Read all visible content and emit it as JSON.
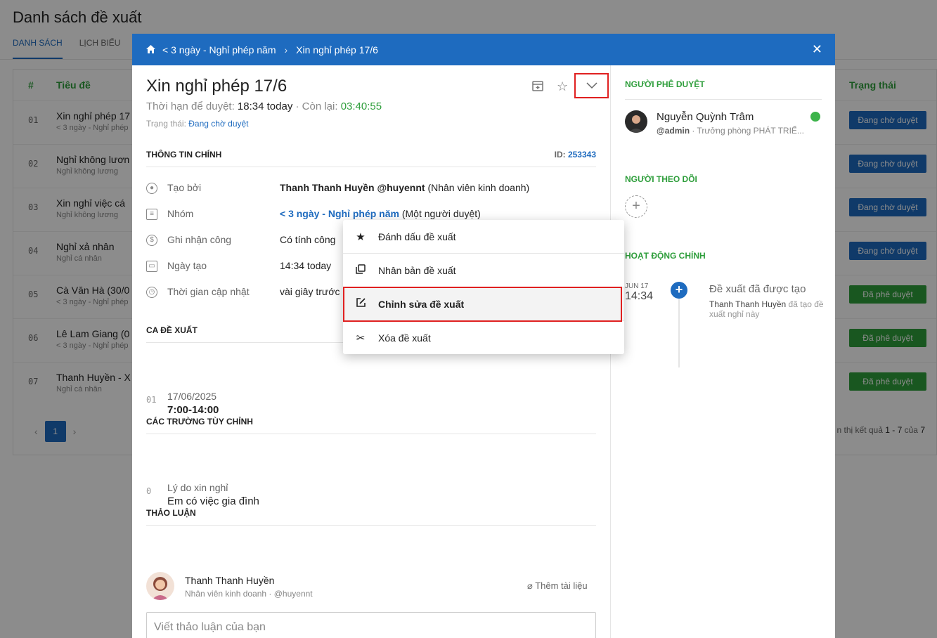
{
  "page": {
    "title": "Danh sách đề xuất",
    "tabs": [
      "DANH SÁCH",
      "LỊCH BIỂU"
    ]
  },
  "table": {
    "headers": {
      "idx": "#",
      "title": "Tiêu đề",
      "status": "Trạng thái"
    },
    "rows": [
      {
        "idx": "01",
        "title": "Xin nghỉ phép 17",
        "sub": "< 3 ngày - Nghỉ phép",
        "status": "Đang chờ duyệt",
        "state": "wait"
      },
      {
        "idx": "02",
        "title": "Nghỉ không lươn",
        "sub": "Nghỉ không lương",
        "status": "Đang chờ duyệt",
        "state": "wait"
      },
      {
        "idx": "03",
        "title": "Xin nghỉ việc cá",
        "sub": "Nghỉ không lương",
        "status": "Đang chờ duyệt",
        "state": "wait"
      },
      {
        "idx": "04",
        "title": "Nghỉ xả nhân",
        "sub": "Nghỉ cá nhân",
        "status": "Đang chờ duyệt",
        "state": "wait"
      },
      {
        "idx": "05",
        "title": "Cà Văn Hà (30/0",
        "sub": "< 3 ngày - Nghỉ phép",
        "status": "Đã phê duyệt",
        "state": "ok"
      },
      {
        "idx": "06",
        "title": "Lê Lam Giang (0",
        "sub": "< 3 ngày - Nghỉ phép",
        "status": "Đã phê duyệt",
        "state": "ok"
      },
      {
        "idx": "07",
        "title": "Thanh Huyền - X",
        "sub": "Nghỉ cá nhân",
        "status": "Đã phê duyệt",
        "state": "ok"
      }
    ],
    "pager": {
      "prev": "‹",
      "current": "1",
      "next": "›"
    },
    "result": {
      "prefix": "n thị kết quả",
      "range": "1 - 7",
      "of": "của",
      "total": "7"
    }
  },
  "modal": {
    "breadcrumb": [
      "< 3 ngày - Nghỉ phép năm",
      "Xin nghỉ phép 17/6"
    ],
    "title": "Xin nghỉ phép 17/6",
    "deadline_label": "Thời hạn để duyệt:",
    "deadline_value": "18:34 today",
    "remaining_label": "· Còn lại:",
    "remaining_value": "03:40:55",
    "status_label": "Trạng thái:",
    "status_value": "Đang chờ duyệt",
    "main_section": "THÔNG TIN CHÍNH",
    "id_label": "ID:",
    "id_value": "253343",
    "info": {
      "created_by_label": "Tạo bởi",
      "created_by_name": "Thanh Thanh Huyền @huyennt",
      "created_by_role": "(Nhân viên kinh doanh)",
      "group_label": "Nhóm",
      "group_link": "< 3 ngày - Nghỉ phép năm",
      "group_note": "(Một người duyệt)",
      "work_label": "Ghi nhận công",
      "work_value": "Có tính công",
      "created_label": "Ngày tạo",
      "created_value": "14:34 today",
      "updated_label": "Thời gian cập nhật",
      "updated_value": "vài giây trước"
    },
    "shift_section": "CA ĐỀ XUẤT",
    "shift": {
      "idx": "01",
      "date": "17/06/2025",
      "time": "7:00-14:00"
    },
    "custom_section": "CÁC TRƯỜNG TÙY CHỈNH",
    "custom": {
      "idx": "0",
      "label": "Lý do xin nghỉ",
      "value": "Em có việc gia đình"
    },
    "discussion_section": "THẢO LUẬN",
    "comment": {
      "name": "Thanh Thanh Huyền",
      "sub": "Nhân viên kinh doanh · @huyennt",
      "attach": "Thêm tài liệu",
      "placeholder": "Viết thảo luận của bạn"
    },
    "right": {
      "approver_section": "NGƯỜI PHÊ DUYỆT",
      "approver_name": "Nguyễn Quỳnh Trâm",
      "approver_handle": "@admin",
      "approver_role": "· Trưởng phòng PHÁT TRIỂ...",
      "follower_section": "NGƯỜI THEO DÕI",
      "activity_section": "HOẠT ĐỘNG CHÍNH",
      "activity_month": "JUN 17",
      "activity_time": "14:34",
      "activity_title": "Đề xuất đã được tạo",
      "activity_actor": "Thanh Thanh Huyền",
      "activity_desc": "đã tạo đề xuất nghỉ này"
    }
  },
  "menu": {
    "items": [
      "Đánh dấu đề xuất",
      "Nhân bản đề xuất",
      "Chỉnh sửa đề xuất",
      "Xóa đề xuất"
    ],
    "selected": "Chỉnh sửa đề xuất"
  },
  "colors": {
    "accent": "#1e6bbf",
    "success": "#2e9e3b",
    "highlight": "#e02020"
  }
}
